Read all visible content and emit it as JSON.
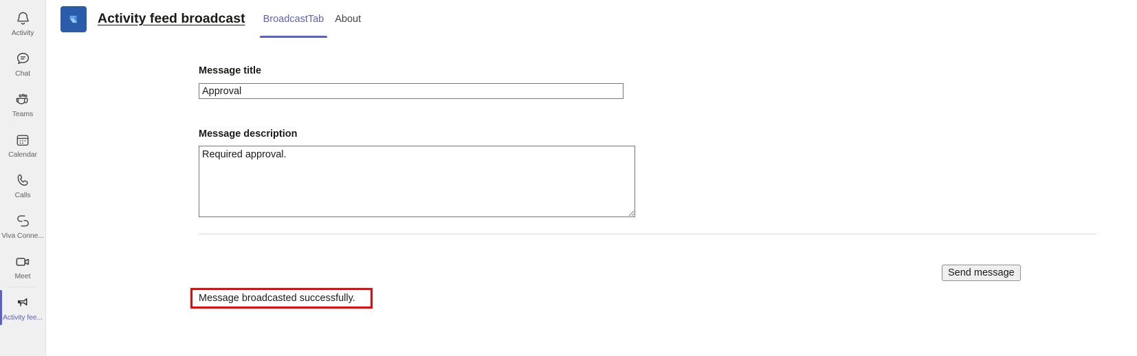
{
  "sidebar": {
    "items": [
      {
        "label": "Activity",
        "icon": "bell-icon",
        "name": "activity",
        "active": false
      },
      {
        "label": "Chat",
        "icon": "chat-icon",
        "name": "chat",
        "active": false
      },
      {
        "label": "Teams",
        "icon": "teams-icon",
        "name": "teams",
        "active": false
      },
      {
        "label": "Calendar",
        "icon": "calendar-icon",
        "name": "calendar",
        "active": false
      },
      {
        "label": "Calls",
        "icon": "phone-icon",
        "name": "calls",
        "active": false
      },
      {
        "label": "Viva Conne...",
        "icon": "viva-connections-icon",
        "name": "viva-connections",
        "active": false
      },
      {
        "label": "Meet",
        "icon": "video-camera-icon",
        "name": "meet",
        "active": false
      },
      {
        "label": "Activity fee...",
        "icon": "broadcast-icon",
        "name": "activity-feed",
        "active": true
      }
    ],
    "accent_color": "#5b5fc7"
  },
  "header": {
    "app_icon_name": "activity-feed-broadcast-app-icon",
    "app_icon_bg": "#2a5caa",
    "title": "Activity feed broadcast",
    "tabs": [
      {
        "label": "BroadcastTab",
        "name": "tab-broadcasttab",
        "active": true
      },
      {
        "label": "About",
        "name": "tab-about",
        "active": false
      }
    ]
  },
  "form": {
    "title_label": "Message title",
    "title_value": "Approval",
    "title_placeholder": "",
    "description_label": "Message description",
    "description_value": "Required approval.",
    "description_placeholder": "",
    "send_button_label": "Send message"
  },
  "status": {
    "message": "Message broadcasted successfully.",
    "border_color": "#fe0000"
  }
}
